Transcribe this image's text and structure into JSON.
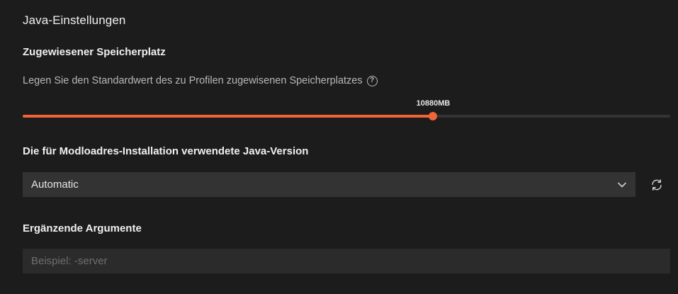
{
  "section": {
    "title": "Java-Einstellungen"
  },
  "memory": {
    "label": "Zugewiesener Speicherplatz",
    "description": "Legen Sie den Standardwert des zu Profilen zugewisenen Speicherplatzes",
    "help_glyph": "?",
    "value_label": "10880MB",
    "fraction": 0.634,
    "accent_color": "#f16436",
    "track_color": "#333333"
  },
  "java_version": {
    "label": "Die für Modloadres-Installation verwendete Java-Version",
    "selected": "Automatic",
    "chevron_icon": "chevron-down-icon",
    "refresh_icon": "refresh-icon"
  },
  "args": {
    "label": "Ergänzende Argumente",
    "value": "",
    "placeholder": "Beispiel: -server"
  }
}
